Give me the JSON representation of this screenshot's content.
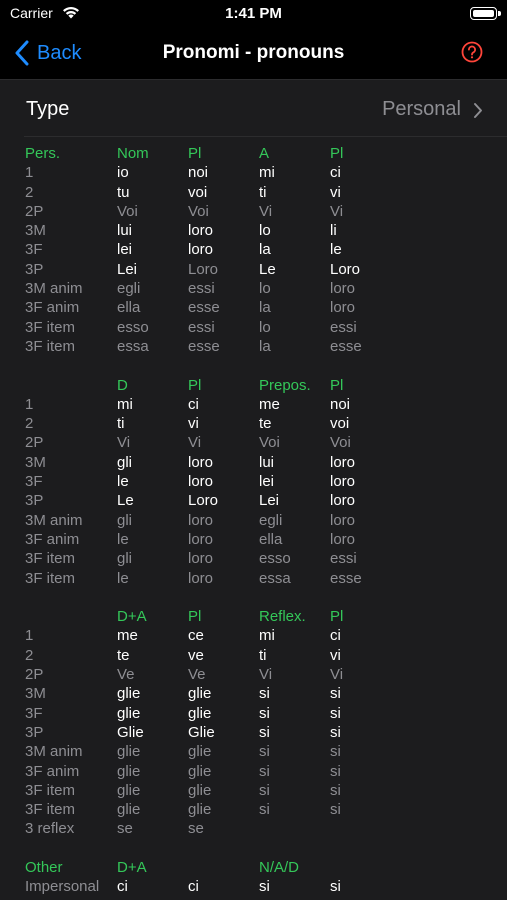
{
  "status": {
    "carrier": "Carrier",
    "time": "1:41 PM"
  },
  "nav": {
    "back_label": "Back",
    "title": "Pronomi - pronouns"
  },
  "type_row": {
    "label": "Type",
    "value": "Personal"
  },
  "colors": {
    "accent": "#1e8cff",
    "header_green": "#34c759",
    "help_red": "#ff453a",
    "secondary": "#8e8e93"
  },
  "sections": [
    {
      "header": [
        "Pers.",
        "Nom",
        "Pl",
        "A",
        "Pl"
      ],
      "rows": [
        {
          "cells": [
            "1",
            "io",
            "noi",
            "mi",
            "ci"
          ],
          "dim": false
        },
        {
          "cells": [
            "2",
            "tu",
            "voi",
            "ti",
            "vi"
          ],
          "dim": false
        },
        {
          "cells": [
            "2P",
            "Voi",
            "Voi",
            "Vi",
            "Vi"
          ],
          "dim": true
        },
        {
          "cells": [
            "3M",
            "lui",
            "loro",
            "lo",
            "li"
          ],
          "dim": false
        },
        {
          "cells": [
            "3F",
            "lei",
            "loro",
            "la",
            "le"
          ],
          "dim": false
        },
        {
          "cells": [
            "3P",
            "Lei",
            "Loro",
            "Le",
            "Loro"
          ],
          "dim": false,
          "dim_cols": [
            2
          ]
        },
        {
          "cells": [
            "3M anim",
            "egli",
            "essi",
            "lo",
            "loro"
          ],
          "dim": true
        },
        {
          "cells": [
            "3F anim",
            "ella",
            "esse",
            "la",
            "loro"
          ],
          "dim": true
        },
        {
          "cells": [
            "3F item",
            "esso",
            "essi",
            "lo",
            "essi"
          ],
          "dim": true
        },
        {
          "cells": [
            "3F item",
            "essa",
            "esse",
            "la",
            "esse"
          ],
          "dim": true
        }
      ]
    },
    {
      "header": [
        "",
        "D",
        "Pl",
        "Prepos.",
        "Pl"
      ],
      "rows": [
        {
          "cells": [
            "1",
            "mi",
            "ci",
            "me",
            "noi"
          ],
          "dim": false
        },
        {
          "cells": [
            "2",
            "ti",
            "vi",
            "te",
            "voi"
          ],
          "dim": false
        },
        {
          "cells": [
            "2P",
            "Vi",
            "Vi",
            "Voi",
            "Voi"
          ],
          "dim": true
        },
        {
          "cells": [
            "3M",
            "gli",
            "loro",
            "lui",
            "loro"
          ],
          "dim": false
        },
        {
          "cells": [
            "3F",
            "le",
            "loro",
            "lei",
            "loro"
          ],
          "dim": false
        },
        {
          "cells": [
            "3P",
            "Le",
            "Loro",
            "Lei",
            "loro"
          ],
          "dim": false
        },
        {
          "cells": [
            "3M anim",
            "gli",
            "loro",
            "egli",
            "loro"
          ],
          "dim": true
        },
        {
          "cells": [
            "3F anim",
            "le",
            "loro",
            "ella",
            "loro"
          ],
          "dim": true
        },
        {
          "cells": [
            "3F item",
            "gli",
            "loro",
            "esso",
            "essi"
          ],
          "dim": true
        },
        {
          "cells": [
            "3F item",
            "le",
            "loro",
            "essa",
            "esse"
          ],
          "dim": true
        }
      ]
    },
    {
      "header": [
        "",
        "D+A",
        "Pl",
        "Reflex.",
        "Pl"
      ],
      "rows": [
        {
          "cells": [
            "1",
            "me",
            "ce",
            "mi",
            "ci"
          ],
          "dim": false
        },
        {
          "cells": [
            "2",
            "te",
            "ve",
            "ti",
            "vi"
          ],
          "dim": false
        },
        {
          "cells": [
            "2P",
            "Ve",
            "Ve",
            "Vi",
            "Vi"
          ],
          "dim": true
        },
        {
          "cells": [
            "3M",
            "glie",
            "glie",
            "si",
            "si"
          ],
          "dim": false
        },
        {
          "cells": [
            "3F",
            "glie",
            "glie",
            "si",
            "si"
          ],
          "dim": false
        },
        {
          "cells": [
            "3P",
            "Glie",
            "Glie",
            "si",
            "si"
          ],
          "dim": false
        },
        {
          "cells": [
            "3M anim",
            "glie",
            "glie",
            "si",
            "si"
          ],
          "dim": true
        },
        {
          "cells": [
            "3F anim",
            "glie",
            "glie",
            "si",
            "si"
          ],
          "dim": true
        },
        {
          "cells": [
            "3F item",
            "glie",
            "glie",
            "si",
            "si"
          ],
          "dim": true
        },
        {
          "cells": [
            "3F item",
            "glie",
            "glie",
            "si",
            "si"
          ],
          "dim": true
        },
        {
          "cells": [
            "3 reflex",
            "se",
            "se",
            "",
            ""
          ],
          "dim": true
        }
      ]
    },
    {
      "header": [
        "Other",
        "D+A",
        "",
        "N/A/D",
        ""
      ],
      "rows": [
        {
          "cells": [
            "Impersonal",
            "ci",
            "ci",
            "si",
            "si"
          ],
          "dim": false
        }
      ]
    }
  ]
}
